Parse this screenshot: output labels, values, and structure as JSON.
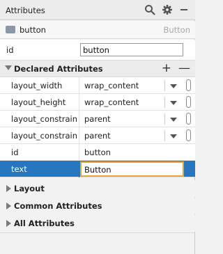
{
  "panel": {
    "title": "Attributes"
  },
  "component": {
    "name": "button",
    "type": "Button"
  },
  "id_field": {
    "label": "id",
    "value": "button"
  },
  "declared": {
    "label": "Declared Attributes",
    "add_label": "+",
    "remove_label": "—",
    "rows": [
      {
        "name": "layout_width",
        "value": "wrap_content"
      },
      {
        "name": "layout_height",
        "value": "wrap_content"
      },
      {
        "name": "layout_constraintEnd_toEndOf",
        "value": "parent"
      },
      {
        "name": "layout_constraintStart_toStartOf",
        "value": "parent"
      },
      {
        "name": "id",
        "value": "button"
      },
      {
        "name": "text",
        "value": "Button"
      }
    ]
  },
  "sections": {
    "layout": "Layout",
    "common": "Common Attributes",
    "all": "All Attributes"
  },
  "colors": {
    "selection": "#2675bf",
    "focus_border": "#e8a33d"
  },
  "icons": {
    "search": "search-icon",
    "settings": "gear-icon",
    "minimize": "minimize-icon"
  }
}
